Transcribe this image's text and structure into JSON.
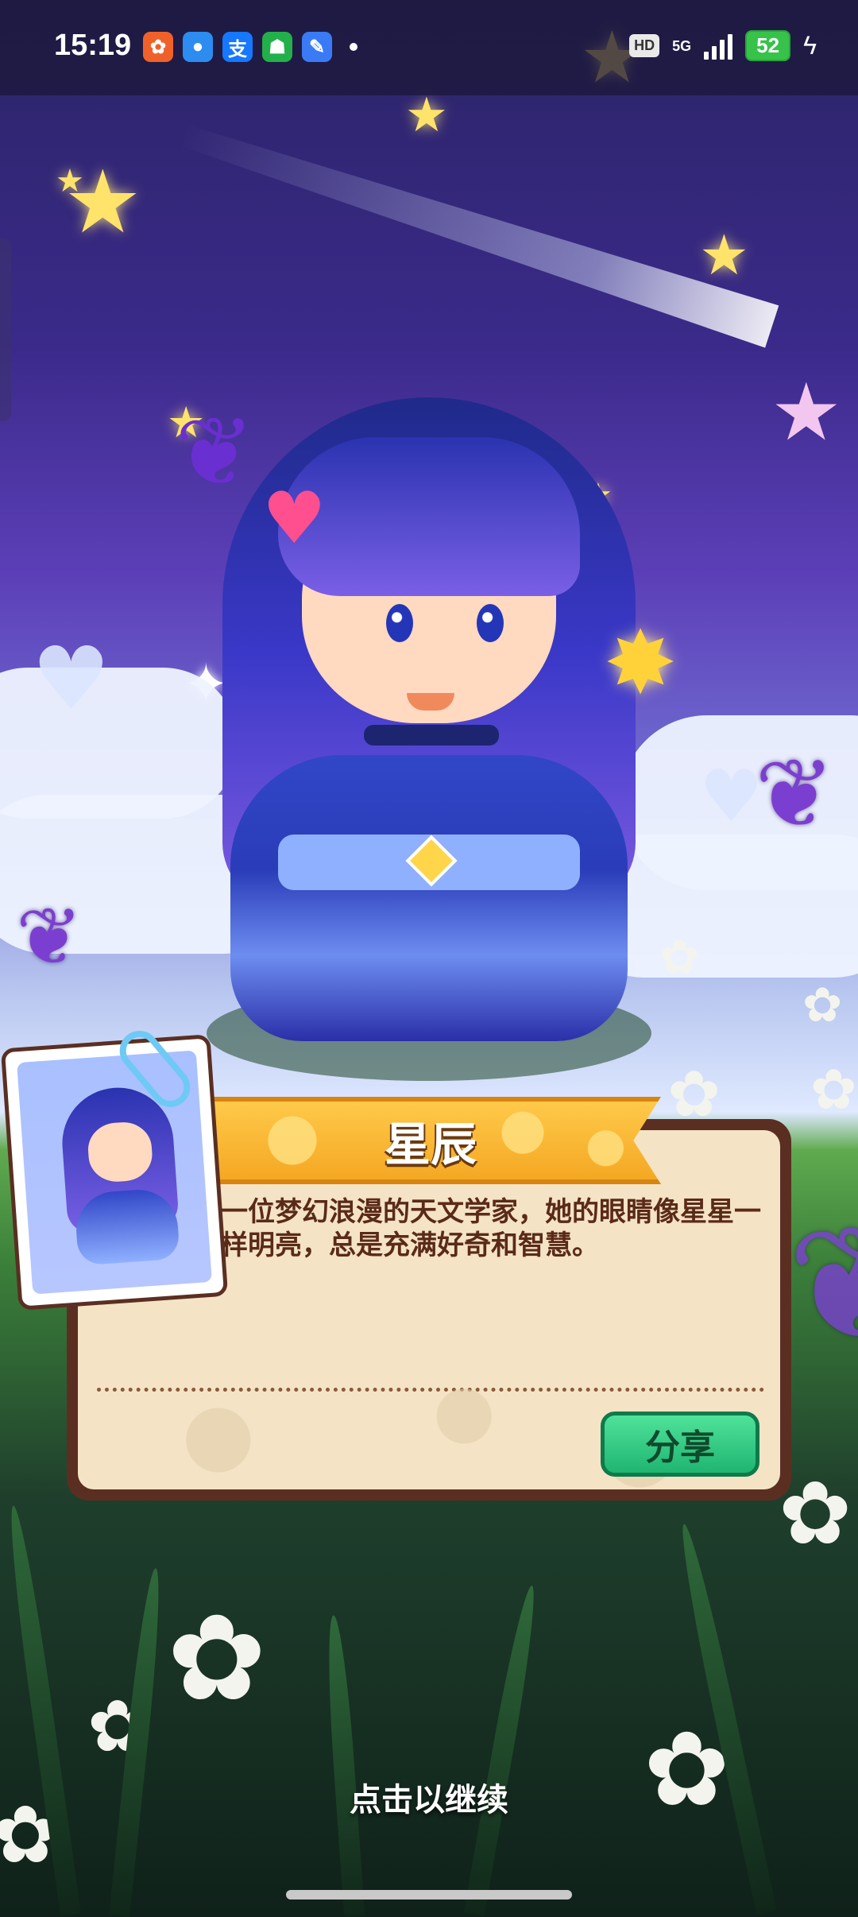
{
  "status_bar": {
    "time": "15:19",
    "apps": [
      {
        "name": "app-icon-1",
        "glyph": "✿",
        "color": "#f0612a"
      },
      {
        "name": "app-icon-2",
        "glyph": "●",
        "color": "#2d8cf0"
      },
      {
        "name": "app-icon-3",
        "glyph": "支",
        "color": "#1677ff"
      },
      {
        "name": "app-icon-4",
        "glyph": "☗",
        "color": "#23b04a"
      },
      {
        "name": "app-icon-5",
        "glyph": "✎",
        "color": "#3a7bf5"
      }
    ],
    "hd": "HD",
    "network": "5G",
    "battery": "52"
  },
  "character": {
    "name": "星辰",
    "description": "一位梦幻浪漫的天文学家，她的眼睛像星星一样明亮，总是充满好奇和智慧。"
  },
  "actions": {
    "share_label": "分享",
    "continue_label": "点击以继续"
  },
  "colors": {
    "banner": "#f4a823",
    "share_button": "#1fb571",
    "card_border": "#5a2f22",
    "card_bg": "#f5e3c6"
  }
}
